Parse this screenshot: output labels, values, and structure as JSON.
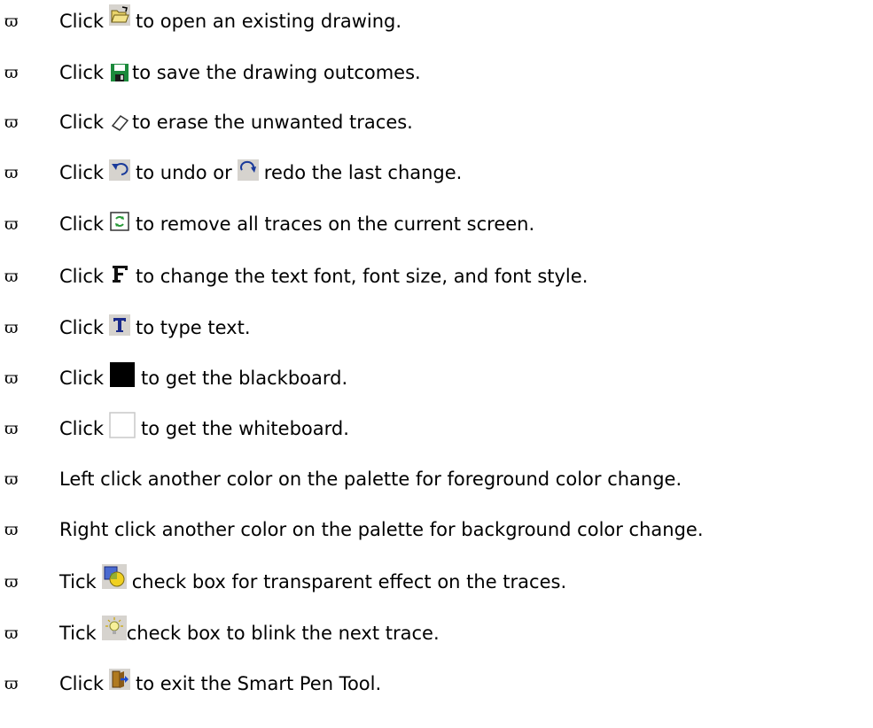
{
  "bullet": "ϖ",
  "items": [
    {
      "pre": "Click",
      "icon": "open-folder-icon",
      "post": "to open an existing drawing."
    },
    {
      "pre": "Click",
      "icon": "save-disk-icon",
      "post": "to save the drawing outcomes."
    },
    {
      "pre": "Click",
      "icon": "eraser-icon",
      "post": "to erase the unwanted traces."
    },
    {
      "pre": "Click",
      "icon": "undo-icon",
      "mid": "to undo or",
      "icon2": "redo-icon",
      "post": "redo the last change."
    },
    {
      "pre": "Click",
      "icon": "clear-screen-icon",
      "post": "to remove all traces on the current screen."
    },
    {
      "pre": "Click",
      "icon": "font-icon",
      "post": "to change the text font, font size, and font style."
    },
    {
      "pre": "Click",
      "icon": "text-tool-icon",
      "post": "to type text."
    },
    {
      "pre": "Click",
      "icon": "blackboard-icon",
      "post": "to get the blackboard."
    },
    {
      "pre": "Click",
      "icon": "whiteboard-icon",
      "post": "to get the whiteboard."
    },
    {
      "pre": "Left click another color on the palette for foreground color change."
    },
    {
      "pre": "Right click another color on the palette for background color change."
    },
    {
      "pre": "Tick",
      "icon": "transparent-effect-icon",
      "post": "check box for transparent effect on the traces."
    },
    {
      "pre": "Tick",
      "icon": "blink-bulb-icon",
      "post": "check box to blink the next trace."
    },
    {
      "pre": "Click",
      "icon": "exit-door-icon",
      "post": "to exit the Smart Pen Tool."
    }
  ]
}
